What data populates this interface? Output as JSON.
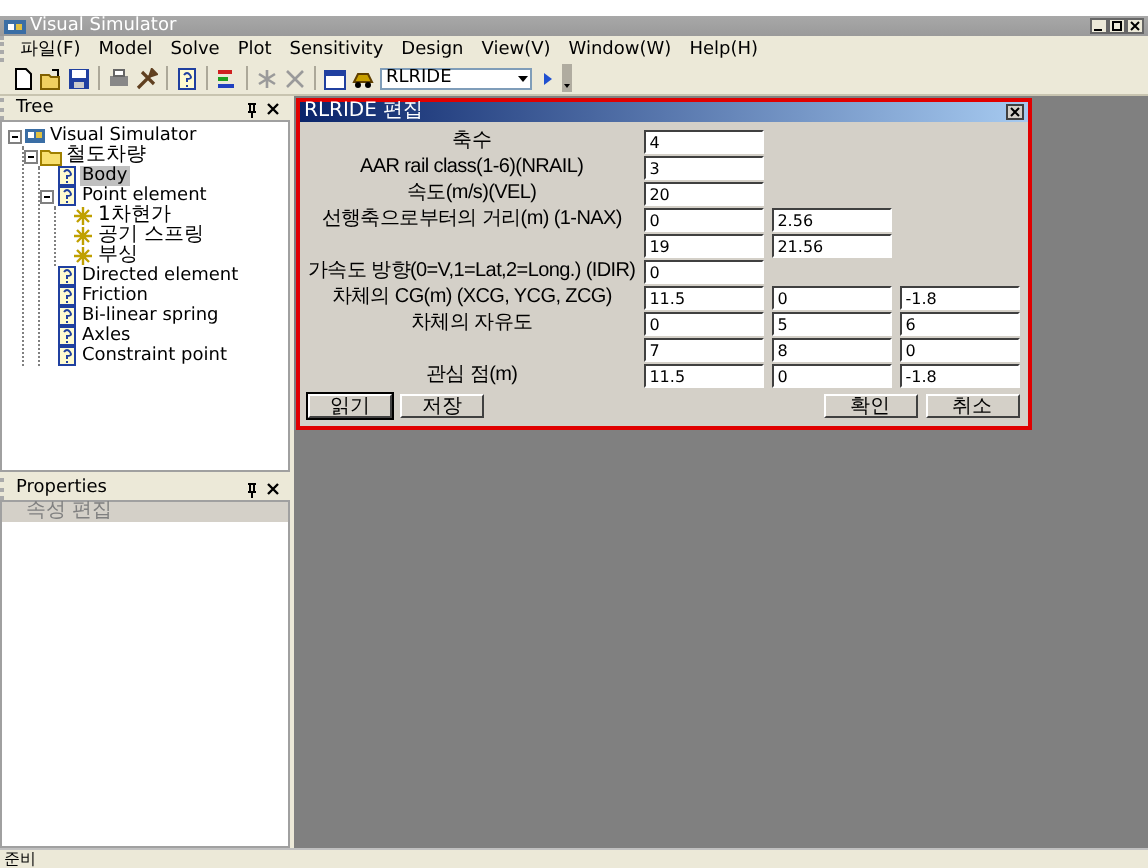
{
  "window": {
    "title": "Visual Simulator"
  },
  "menu": [
    {
      "label": "파일(F)"
    },
    {
      "label": "Model"
    },
    {
      "label": "Solve"
    },
    {
      "label": "Plot"
    },
    {
      "label": "Sensitivity"
    },
    {
      "label": "Design"
    },
    {
      "label": "View(V)"
    },
    {
      "label": "Window(W)"
    },
    {
      "label": "Help(H)"
    }
  ],
  "toolbar": {
    "combo": {
      "value": "RLRIDE"
    }
  },
  "tree_panel": {
    "title": "Tree",
    "nodes": [
      {
        "label": "Visual Simulator",
        "kind": "app",
        "expanded": true,
        "selected": false,
        "children": [
          {
            "label": "철도차량",
            "kind": "folder",
            "expanded": true,
            "selected": false,
            "children": [
              {
                "label": "Body",
                "kind": "item",
                "selected": true
              },
              {
                "label": "Point element",
                "kind": "item",
                "expanded": true,
                "selected": false,
                "children": [
                  {
                    "label": "1차현가",
                    "kind": "point",
                    "selected": false
                  },
                  {
                    "label": "공기 스프링",
                    "kind": "point",
                    "selected": false
                  },
                  {
                    "label": "부싱",
                    "kind": "point",
                    "selected": false
                  }
                ]
              },
              {
                "label": "Directed element",
                "kind": "item",
                "selected": false
              },
              {
                "label": "Friction",
                "kind": "item",
                "selected": false
              },
              {
                "label": "Bi-linear spring",
                "kind": "item",
                "selected": false
              },
              {
                "label": "Axles",
                "kind": "item",
                "selected": false
              },
              {
                "label": "Constraint point",
                "kind": "item",
                "selected": false
              }
            ]
          }
        ]
      }
    ]
  },
  "properties_panel": {
    "title": "Properties",
    "header": "속성 편집"
  },
  "dialog": {
    "title": "RLRIDE 편집",
    "rows": [
      {
        "label": "축수",
        "values": [
          "4"
        ]
      },
      {
        "label": "AAR rail class(1-6)(NRAIL)",
        "values": [
          "3"
        ]
      },
      {
        "label": "속도(m/s)(VEL)",
        "values": [
          "20"
        ]
      },
      {
        "label": "선행축으로부터의 거리(m) (1-NAX)",
        "values": [
          "0",
          "2.56"
        ]
      },
      {
        "values": [
          "19",
          "21.56"
        ]
      },
      {
        "label": "가속도 방향(0=V,1=Lat,2=Long.) (IDIR)",
        "values": [
          "0"
        ]
      },
      {
        "label": "차체의 CG(m) (XCG, YCG, ZCG)",
        "values": [
          "11.5",
          "0",
          "-1.8"
        ]
      },
      {
        "label": "차체의 자유도",
        "values": [
          "0",
          "5",
          "6"
        ]
      },
      {
        "values": [
          "7",
          "8",
          "0"
        ]
      },
      {
        "label": "관심 점(m)",
        "values": [
          "11.5",
          "0",
          "-1.8"
        ]
      }
    ],
    "buttons_left": [
      {
        "label": "읽기",
        "default": true
      },
      {
        "label": "저장",
        "default": false
      }
    ],
    "buttons_right": [
      {
        "label": "확인",
        "default": false
      },
      {
        "label": "취소",
        "default": false
      }
    ]
  },
  "status_bar": {
    "text": "준비"
  }
}
